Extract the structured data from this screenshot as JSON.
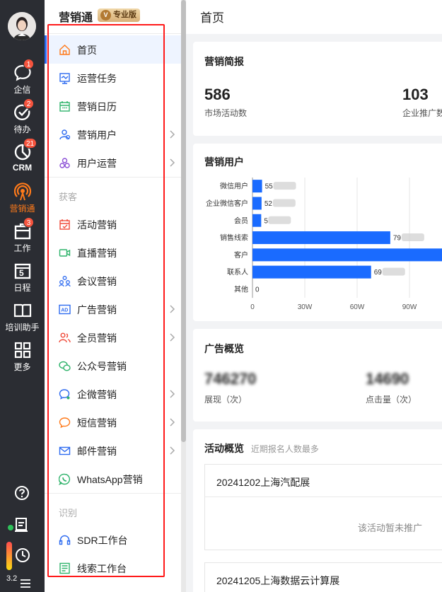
{
  "rail": {
    "items": [
      {
        "label": "企信",
        "badge": "1"
      },
      {
        "label": "待办",
        "badge": "2"
      },
      {
        "label": "CRM",
        "badge": "21"
      },
      {
        "label": "营销通",
        "badge": ""
      },
      {
        "label": "工作",
        "badge": "3"
      },
      {
        "label": "日程",
        "badge": ""
      },
      {
        "label": "培训助手",
        "badge": ""
      },
      {
        "label": "更多",
        "badge": ""
      }
    ],
    "version": "3.2",
    "calendar_day": "5",
    "accent": "#ff7a1a"
  },
  "sidebar": {
    "app_title": "营销通",
    "pro_badge": "专业版",
    "pro_badge_v": "V",
    "items_top": [
      {
        "label": "首页",
        "icon": "home-icon"
      },
      {
        "label": "运营任务",
        "icon": "task-icon"
      },
      {
        "label": "营销日历",
        "icon": "calendar-icon"
      },
      {
        "label": "营销用户",
        "icon": "users-icon"
      },
      {
        "label": "用户运营",
        "icon": "user-ops-icon"
      }
    ],
    "section_acquire": "获客",
    "items_acquire": [
      {
        "label": "活动营销",
        "icon": "event-icon"
      },
      {
        "label": "直播营销",
        "icon": "live-icon"
      },
      {
        "label": "会议营销",
        "icon": "meeting-icon"
      },
      {
        "label": "广告营销",
        "icon": "ad-icon"
      },
      {
        "label": "全员营销",
        "icon": "all-staff-icon"
      },
      {
        "label": "公众号营销",
        "icon": "wechat-icon"
      },
      {
        "label": "企微营销",
        "icon": "wecom-icon"
      },
      {
        "label": "短信营销",
        "icon": "sms-icon"
      },
      {
        "label": "邮件营销",
        "icon": "mail-icon"
      },
      {
        "label": "WhatsApp营销",
        "icon": "whatsapp-icon"
      }
    ],
    "section_identify": "识别",
    "items_identify": [
      {
        "label": "SDR工作台",
        "icon": "headset-icon"
      },
      {
        "label": "线索工作台",
        "icon": "lead-icon"
      }
    ]
  },
  "main": {
    "page_title": "首页",
    "brief": {
      "title": "营销简报",
      "stat1_value": "586",
      "stat1_label": "市场活动数",
      "stat2_value": "103",
      "stat2_label": "企业推广数"
    },
    "users_card": {
      "title": "营销用户"
    },
    "ads": {
      "title": "广告概览",
      "stat1_value": "746270",
      "stat1_label": "展现（次）",
      "stat2_value": "14690",
      "stat2_label": "点击量（次）"
    },
    "activity": {
      "title": "活动概览",
      "subtitle": "近期报名人数最多",
      "items": [
        {
          "name": "20241202上海汽配展",
          "empty": "该活动暂未推广"
        },
        {
          "name": "20241205上海数据云计算展",
          "empty": ""
        }
      ]
    }
  },
  "chart_data": {
    "type": "bar",
    "orientation": "horizontal",
    "categories": [
      "微信用户",
      "企业微信客户",
      "会员",
      "销售线索",
      "客户",
      "联系人",
      "其他"
    ],
    "values": [
      55000,
      52000,
      50000,
      790000,
      1200000,
      680000,
      0
    ],
    "value_labels": [
      "55",
      "52",
      "5",
      "79",
      "",
      "69",
      "0"
    ],
    "xticks": [
      "0",
      "30W",
      "60W",
      "90W"
    ],
    "xlim": [
      0,
      1200000
    ],
    "grid": true,
    "bar_color": "#1a6bff"
  }
}
